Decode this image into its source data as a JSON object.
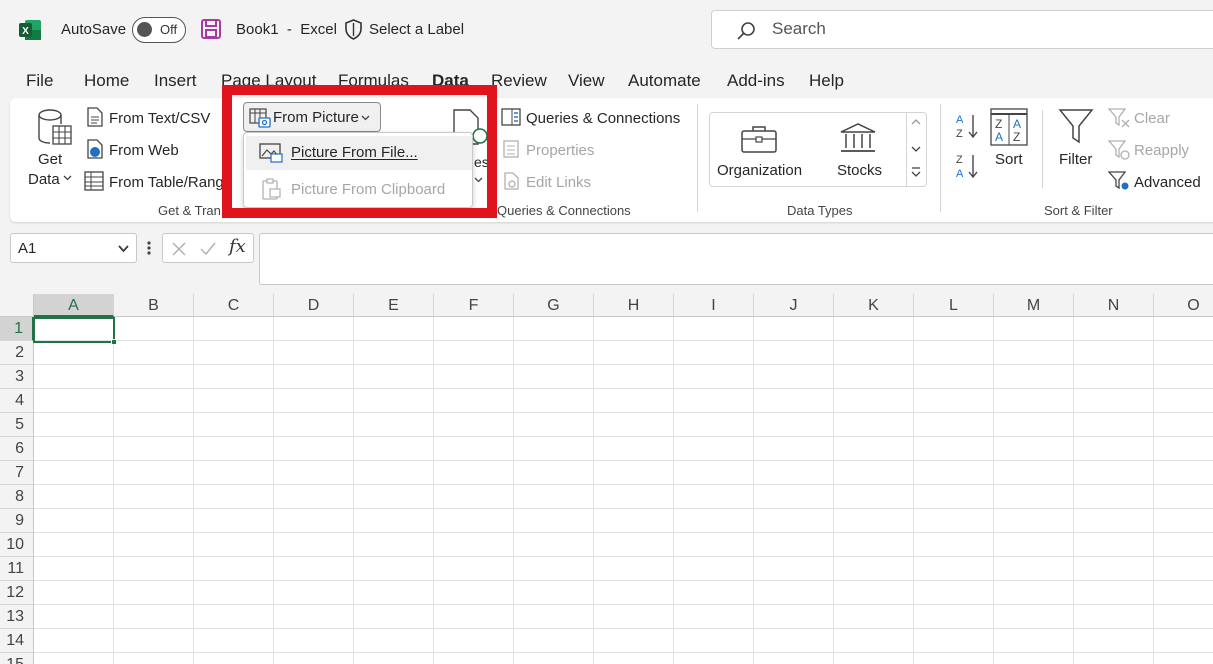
{
  "titlebar": {
    "autosave_label": "AutoSave",
    "autosave_state": "Off",
    "book_name": "Book1",
    "separator": "-",
    "app_name": "Excel",
    "sensitivity_label": "Select a Label",
    "search_placeholder": "Search"
  },
  "tabs": [
    "File",
    "Home",
    "Insert",
    "Page Layout",
    "Formulas",
    "Data",
    "Review",
    "View",
    "Automate",
    "Add-ins",
    "Help"
  ],
  "active_tab": "Data",
  "ribbon": {
    "get_data": [
      "Get",
      "Data"
    ],
    "from_text_csv": "From Text/CSV",
    "from_web": "From Web",
    "from_table_range": "From Table/Rang",
    "from_picture": "From Picture",
    "get_transform_label": "Get & Tran",
    "refresh_fragment": "esh",
    "queries_connections": "Queries & Connections",
    "properties": "Properties",
    "edit_links": "Edit Links",
    "queries_group_label": "Queries & Connections",
    "data_types": [
      "Organization",
      "Stocks"
    ],
    "data_types_label": "Data Types",
    "sort": "Sort",
    "filter": "Filter",
    "clear": "Clear",
    "reapply": "Reapply",
    "advanced": "Advanced",
    "sort_filter_label": "Sort & Filter"
  },
  "dropdown": {
    "picture_from_file": "Picture From File...",
    "picture_from_clipboard": "Picture From Clipboard"
  },
  "formula_bar": {
    "name_box": "A1",
    "fx": "fx",
    "formula": ""
  },
  "grid": {
    "columns": [
      "A",
      "B",
      "C",
      "D",
      "E",
      "F",
      "G",
      "H",
      "I",
      "J",
      "K",
      "L",
      "M",
      "N",
      "O"
    ],
    "rows": [
      "1",
      "2",
      "3",
      "4",
      "5",
      "6",
      "7",
      "8",
      "9",
      "10",
      "11",
      "12",
      "13",
      "14",
      "15"
    ],
    "active_cell": "A1"
  },
  "colors": {
    "excel_green": "#217346",
    "highlight_red": "#e0141e"
  }
}
